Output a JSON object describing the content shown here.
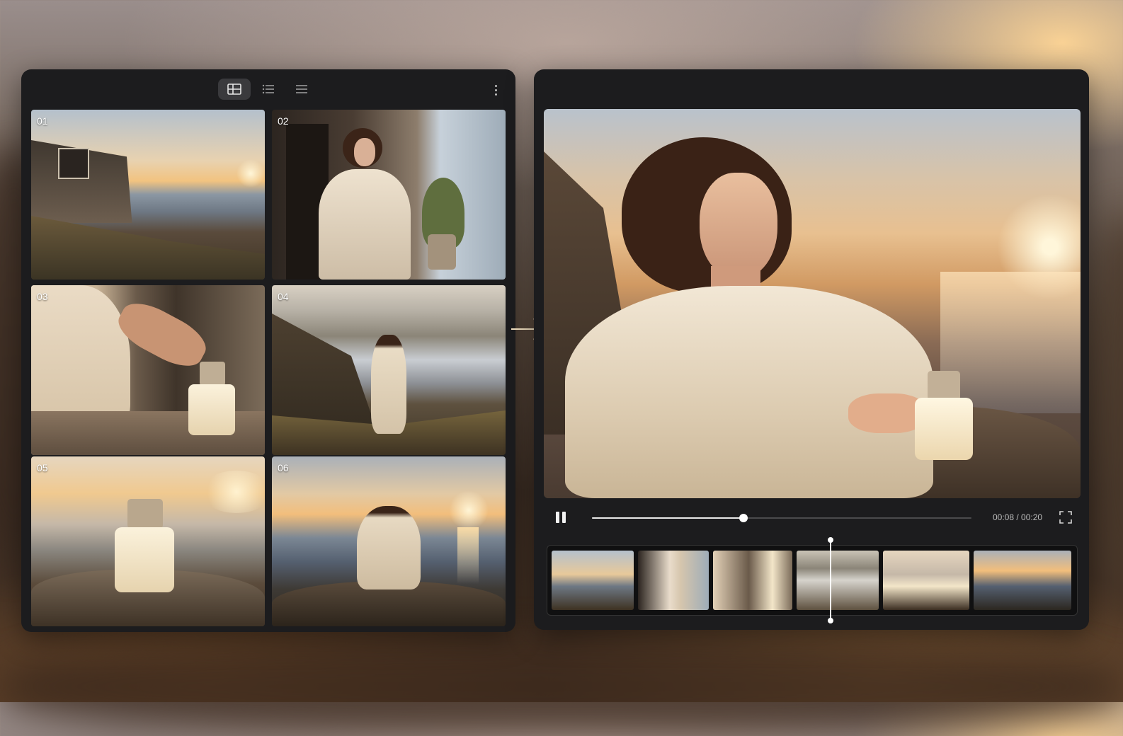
{
  "grid_panel": {
    "view_modes": [
      {
        "name": "grid-view",
        "active": true
      },
      {
        "name": "list-view",
        "active": false
      },
      {
        "name": "compact-list-view",
        "active": false
      }
    ],
    "more_icon": "more-vertical-icon",
    "tiles": [
      {
        "number": "01",
        "scene": "coastal stone house at sunset"
      },
      {
        "number": "02",
        "scene": "woman in cream coat on porch"
      },
      {
        "number": "03",
        "scene": "hand placing perfume bottle"
      },
      {
        "number": "04",
        "scene": "woman walking on rocky coast"
      },
      {
        "number": "05",
        "scene": "perfume bottle on rock by sea"
      },
      {
        "number": "06",
        "scene": "woman seated facing sunset"
      }
    ]
  },
  "player": {
    "time_display": "00:08 / 00:20",
    "progress": 0.4,
    "play_state": "playing",
    "pause_icon": "pause-icon",
    "fullscreen_icon": "fullscreen-icon",
    "filmstrip_playhead": 0.535,
    "filmstrip_frames": [
      "01",
      "02",
      "03",
      "04",
      "05",
      "06"
    ]
  },
  "colors": {
    "panel": "#1c1c1e",
    "active_view": "#3a3a3d",
    "sunset": "#f2c47e",
    "coat": "#efe4d2"
  }
}
